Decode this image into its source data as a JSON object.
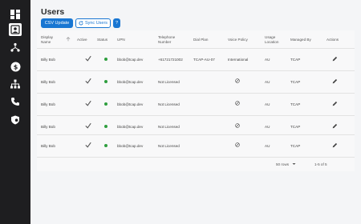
{
  "sidebar": {
    "items": [
      {
        "name": "dashboard-icon",
        "active": false
      },
      {
        "name": "users-icon",
        "active": true
      },
      {
        "name": "flow-icon",
        "active": false
      },
      {
        "name": "billing-icon",
        "active": false
      },
      {
        "name": "org-chart-icon",
        "active": false
      },
      {
        "name": "phone-icon",
        "active": false
      },
      {
        "name": "shield-icon",
        "active": false
      }
    ]
  },
  "page": {
    "title": "Users",
    "csv_button": "CSV Update",
    "sync_button": "Sync Users",
    "help_button": "?"
  },
  "table": {
    "headers": {
      "display_name": "Display Name",
      "active": "Active",
      "status": "Status",
      "upn": "UPN",
      "telephone": "Telephone Number",
      "dial_plan": "Dial Plan",
      "voice_policy": "Voice Policy",
      "usage_location": "Usage Location",
      "managed_by": "Managed By",
      "actions": "Actions"
    },
    "rows": [
      {
        "display_name": "Billy Bob",
        "upn": "bbob@tcap.dev",
        "telephone": "+61721721002",
        "dial_plan": "TCAP-AU-07",
        "voice_policy": "International",
        "usage_location": "AU",
        "managed_by": "TCAP"
      },
      {
        "display_name": "Billy Bob",
        "upn": "bbob@tcap.dev",
        "telephone": "Not Licensed",
        "dial_plan": "",
        "voice_policy": "",
        "usage_location": "AU",
        "managed_by": "TCAP"
      },
      {
        "display_name": "Billy Bob",
        "upn": "bbob@tcap.dev",
        "telephone": "Not Licensed",
        "dial_plan": "",
        "voice_policy": "",
        "usage_location": "AU",
        "managed_by": "TCAP"
      },
      {
        "display_name": "Billy Bob",
        "upn": "bbob@tcap.dev",
        "telephone": "Not Licensed",
        "dial_plan": "",
        "voice_policy": "",
        "usage_location": "AU",
        "managed_by": "TCAP"
      },
      {
        "display_name": "Billy Bob",
        "upn": "bbob@tcap.dev",
        "telephone": "Not Licensed",
        "dial_plan": "",
        "voice_policy": "",
        "usage_location": "AU",
        "managed_by": "TCAP"
      }
    ]
  },
  "pagination": {
    "rows_per_page": "50 rows",
    "range": "1-5 of 5"
  },
  "colors": {
    "accent": "#1976d2",
    "status_green": "#2e9e3e",
    "sidebar_bg": "#1e1e20"
  }
}
